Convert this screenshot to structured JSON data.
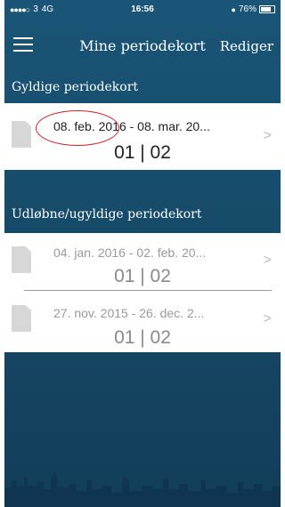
{
  "status_bar": {
    "carrier": "3",
    "network": "4G",
    "time": "16:56",
    "battery": "76%"
  },
  "nav": {
    "title": "Mine periodekort",
    "edit_label": "Rediger",
    "menu_icon": "hamburger-menu-icon"
  },
  "sections": {
    "valid_header": "Gyldige periodekort",
    "expired_header": "Udløbne/ugyldige periodekort"
  },
  "valid_cards": [
    {
      "date_range": "08. feb. 2016 - 08. mar. 20...",
      "zones": "01 | 02"
    }
  ],
  "expired_cards": [
    {
      "date_range": "04. jan. 2016 - 02. feb. 20...",
      "zones": "01 | 02"
    },
    {
      "date_range": "27. nov. 2015 - 26. dec. 2...",
      "zones": "01 | 02"
    }
  ],
  "colors": {
    "background": "#1a5577",
    "annotation": "#cc2222"
  }
}
